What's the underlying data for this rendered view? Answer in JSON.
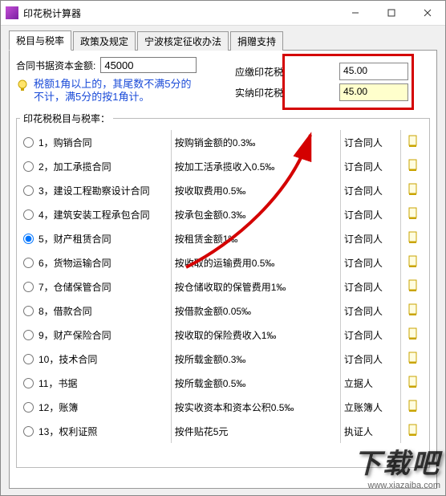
{
  "window": {
    "title": "印花税计算器"
  },
  "tabs": [
    "税目与税率",
    "政策及规定",
    "宁波核定征收办法",
    "捐赠支持"
  ],
  "active_tab_index": 0,
  "amount_label": "合同书据资本金额:",
  "amount_value": "45000",
  "due_label": "应缴印花税",
  "due_value": "45.00",
  "paid_label": "实纳印花税",
  "paid_value": "45.00",
  "hint": "税额1角以上的，其尾数不满5分的不计，满5分的按1角计。",
  "categories_legend": "印花税税目与税率：",
  "selected_category_index": 4,
  "categories": [
    {
      "no": "1",
      "name": "购销合同",
      "desc": "按购销金额的0.3‰",
      "party": "订合同人"
    },
    {
      "no": "2",
      "name": "加工承揽合同",
      "desc": "按加工活承揽收入0.5‰",
      "party": "订合同人"
    },
    {
      "no": "3",
      "name": "建设工程勘察设计合同",
      "desc": "按收取费用0.5‰",
      "party": "订合同人"
    },
    {
      "no": "4",
      "name": "建筑安装工程承包合同",
      "desc": "按承包金额0.3‰",
      "party": "订合同人"
    },
    {
      "no": "5",
      "name": "财产租赁合同",
      "desc": "按租赁金额1‰",
      "party": "订合同人"
    },
    {
      "no": "6",
      "name": "货物运输合同",
      "desc": "按收取的运输费用0.5‰",
      "party": "订合同人"
    },
    {
      "no": "7",
      "name": "仓储保管合同",
      "desc": "按仓储收取的保管费用1‰",
      "party": "订合同人"
    },
    {
      "no": "8",
      "name": "借款合同",
      "desc": "按借款金额0.05‰",
      "party": "订合同人"
    },
    {
      "no": "9",
      "name": "财产保险合同",
      "desc": "按收取的保险费收入1‰",
      "party": "订合同人"
    },
    {
      "no": "10",
      "name": "技术合同",
      "desc": "按所载金额0.3‰",
      "party": "订合同人"
    },
    {
      "no": "11",
      "name": "书据",
      "desc": "按所载金额0.5‰",
      "party": "立据人"
    },
    {
      "no": "12",
      "name": "账簿",
      "desc": "按实收资本和资本公积0.5‰",
      "party": "立账簿人"
    },
    {
      "no": "13",
      "name": "权利证照",
      "desc": "按件贴花5元",
      "party": "执证人"
    }
  ],
  "watermark": {
    "text": "下载吧",
    "url": "www.xiazaiba.com"
  }
}
